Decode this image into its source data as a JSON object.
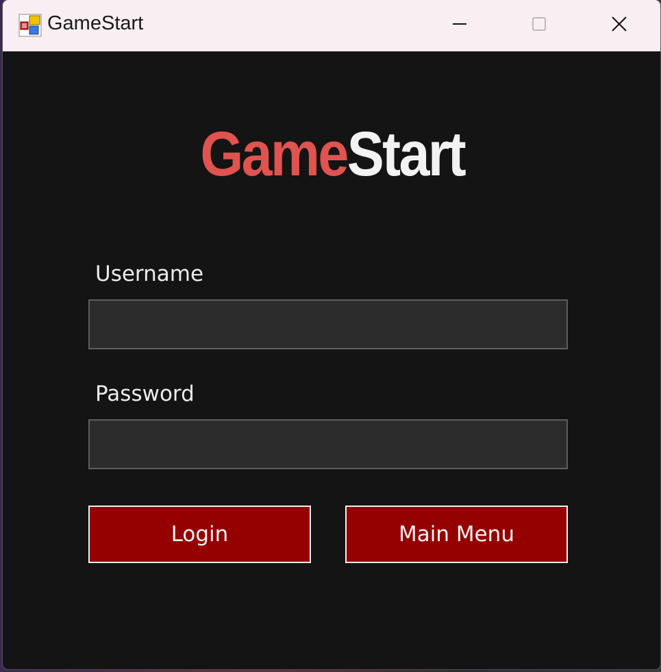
{
  "window": {
    "title": "GameStart",
    "icon": "windows-form-app-icon"
  },
  "titlebar": {
    "minimize_icon": "minimize-icon",
    "maximize_icon": "maximize-icon",
    "close_icon": "close-icon"
  },
  "logo": {
    "part1": "Game",
    "part2": "Start",
    "part1_color": "#e0534f",
    "part2_color": "#f2f2f2"
  },
  "form": {
    "username_label": "Username",
    "username_value": "",
    "password_label": "Password",
    "password_value": ""
  },
  "buttons": {
    "login_label": "Login",
    "main_menu_label": "Main Menu"
  },
  "colors": {
    "window_bg": "#141414",
    "titlebar_bg": "#f9eef2",
    "button_bg": "#950000",
    "input_bg": "#2c2c2c"
  }
}
